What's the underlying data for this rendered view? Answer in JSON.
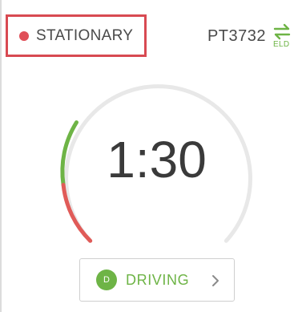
{
  "status": {
    "label": "STATIONARY",
    "dot_color": "#e04f58",
    "highlight_color": "#d84a52"
  },
  "vehicle": {
    "id": "PT3732",
    "eld_label": "ELD",
    "eld_icon": "swap-arrows-icon"
  },
  "timer": {
    "value": "1:30",
    "track_color": "#e8e8e8",
    "progress_color": "#6eb446",
    "warning_color": "#e05b58"
  },
  "duty": {
    "code": "D",
    "label": "DRIVING",
    "color": "#6eb446",
    "chevron_icon": "chevron-right-icon"
  }
}
